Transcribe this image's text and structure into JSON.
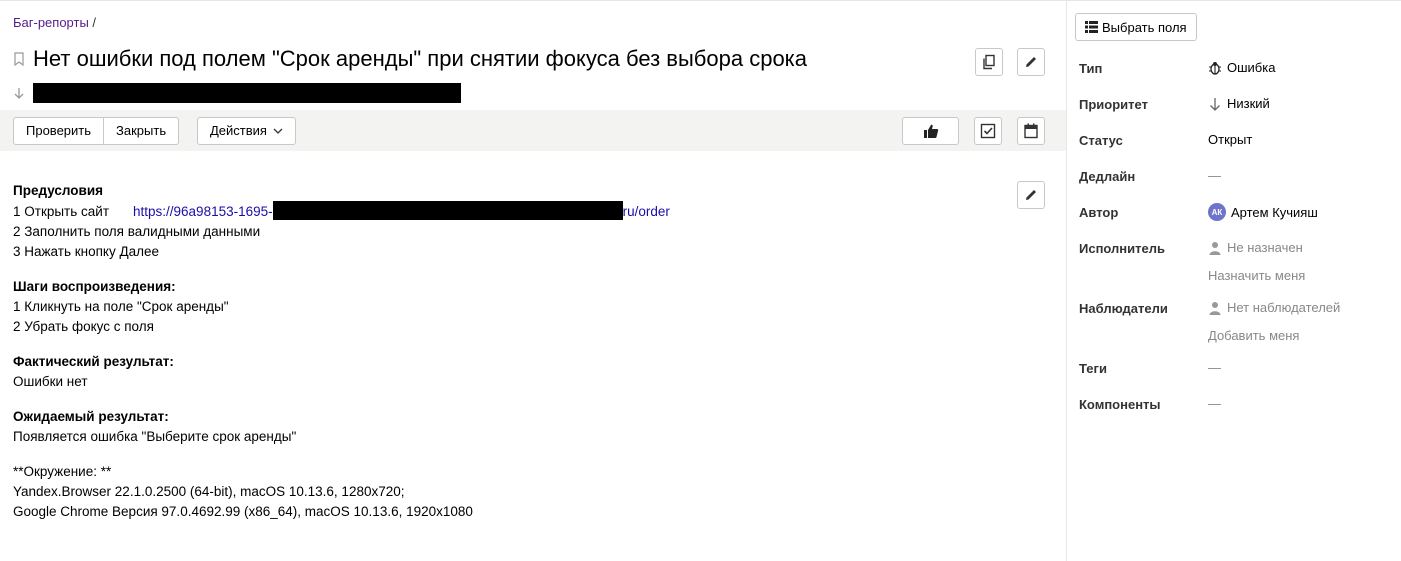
{
  "breadcrumb": {
    "link": "Баг-репорты",
    "separator": " /"
  },
  "issue": {
    "title": "Нет ошибки под полем \"Срок аренды\" при снятии фокуса без выбора срока"
  },
  "toolbar": {
    "check_label": "Проверить",
    "close_label": "Закрыть",
    "actions_label": "Действия"
  },
  "description": {
    "preconditions_title": "Предусловия",
    "pre_1_text": "1 Открыть сайт",
    "pre_1_link_start": "https://96a98153-1695-",
    "pre_1_link_end": "ru/order",
    "pre_2": "2 Заполнить поля валидными данными",
    "pre_3": "3 Нажать кнопку Далее",
    "steps_title": "Шаги воспроизведения:",
    "step_1": "1 Кликнуть на поле \"Срок аренды\"",
    "step_2": "2 Убрать фокус с поля",
    "actual_title": "Фактический результат:",
    "actual_text": "Ошибки нет",
    "expected_title": "Ожидаемый результат:",
    "expected_text": "Появляется ошибка \"Выберите срок аренды\"",
    "env_title": "**Окружение: **",
    "env_1": "Yandex.Browser 22.1.0.2500 (64-bit), macOS 10.13.6, 1280x720;",
    "env_2": "Google Chrome Версия 97.0.4692.99 (x86_64), macOS 10.13.6, 1920x1080"
  },
  "sidebar": {
    "choose_fields_label": "Выбрать поля",
    "type_label": "Тип",
    "type_value": "Ошибка",
    "priority_label": "Приоритет",
    "priority_value": "Низкий",
    "status_label": "Статус",
    "status_value": "Открыт",
    "deadline_label": "Дедлайн",
    "deadline_value": "—",
    "author_label": "Автор",
    "author_initials": "АК",
    "author_value": "Артем Кучияш",
    "assignee_label": "Исполнитель",
    "assignee_value": "Не назначен",
    "assign_me": "Назначить меня",
    "watchers_label": "Наблюдатели",
    "watchers_value": "Нет наблюдателей",
    "add_me": "Добавить меня",
    "tags_label": "Теги",
    "tags_value": "—",
    "components_label": "Компоненты",
    "components_value": "—"
  },
  "colors": {
    "link": "#551a8b",
    "url_link": "#1a0dab",
    "toolbar_bg": "#f3f3f1",
    "avatar_bg": "#6d74c9",
    "muted": "#888888"
  },
  "icons": [
    "bookmark-icon",
    "arrow-down-icon",
    "copy-icon",
    "pencil-icon",
    "thumbs-up-icon",
    "checkbox-icon",
    "calendar-icon",
    "fields-icon",
    "bug-icon",
    "person-icon",
    "chevron-down-icon"
  ]
}
